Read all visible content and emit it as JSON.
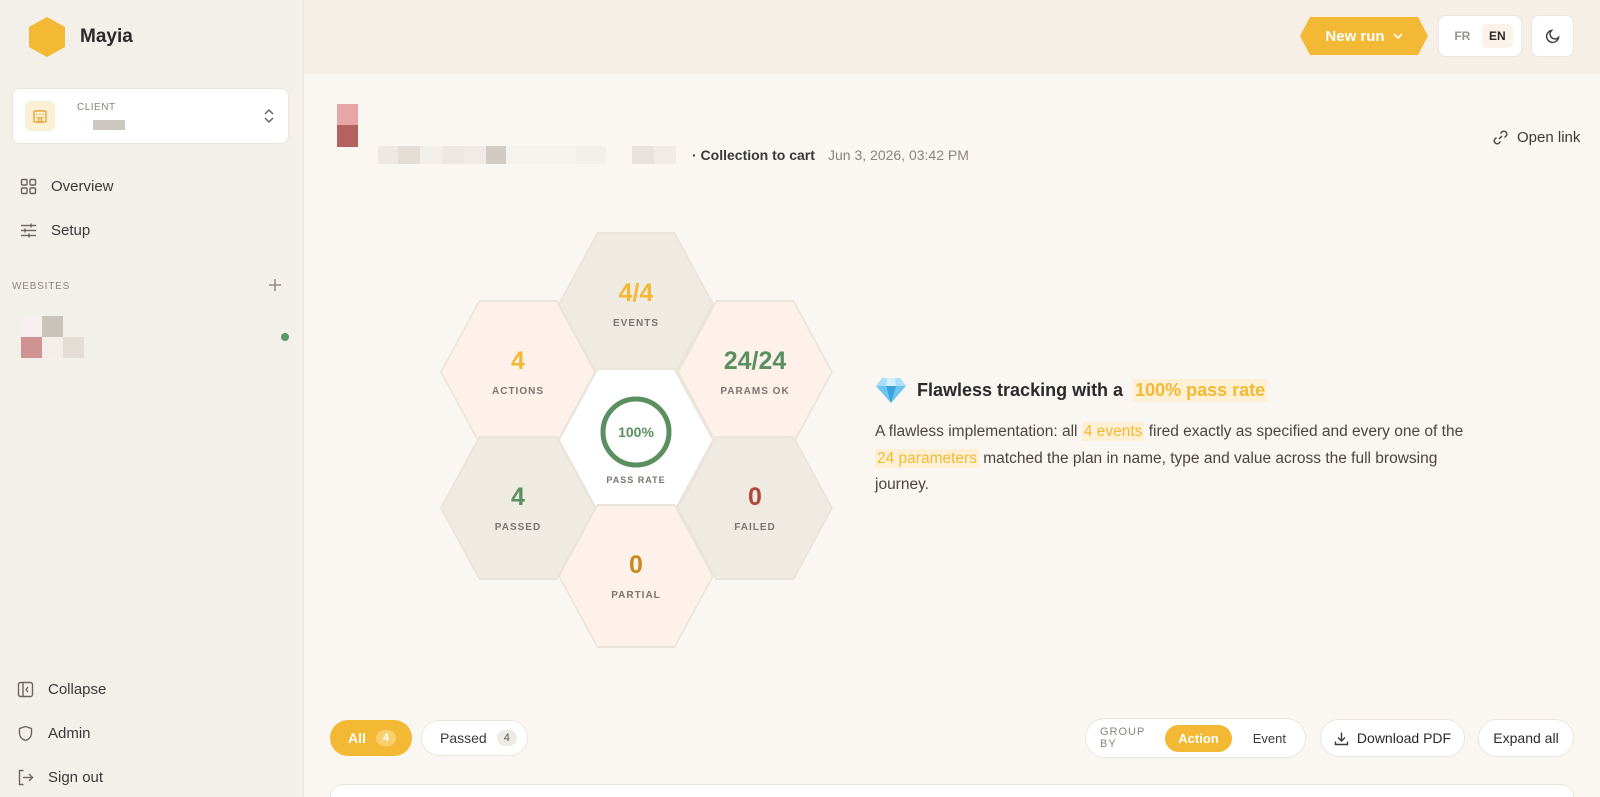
{
  "app": {
    "name": "Mayia"
  },
  "colors": {
    "accent": "#f3b934",
    "success": "#5a8f5f",
    "danger": "#b0473a",
    "warning": "#c8891e"
  },
  "sidebar": {
    "client_label": "CLIENT",
    "nav": [
      {
        "label": "Overview",
        "icon": "grid-icon"
      },
      {
        "label": "Setup",
        "icon": "sliders-icon"
      }
    ],
    "websites_label": "WEBSITES",
    "bottom": [
      {
        "label": "Collapse",
        "icon": "sidebar-collapse-icon"
      },
      {
        "label": "Admin",
        "icon": "shield-icon"
      },
      {
        "label": "Sign out",
        "icon": "sign-out-icon"
      }
    ]
  },
  "topbar": {
    "new_run_label": "New run",
    "lang_fr": "FR",
    "lang_en": "EN",
    "active_lang": "EN"
  },
  "run": {
    "name": "· Collection to cart",
    "date": "Jun 3, 2026, 03:42 PM",
    "open_link_label": "Open link"
  },
  "stats": {
    "events": {
      "value": "4/4",
      "label": "EVENTS"
    },
    "actions": {
      "value": "4",
      "label": "ACTIONS"
    },
    "params": {
      "value": "24/24",
      "label": "PARAMS OK"
    },
    "pass_rate": {
      "value": "100%",
      "label": "PASS RATE",
      "fraction": 1.0
    },
    "passed": {
      "value": "4",
      "label": "PASSED"
    },
    "failed": {
      "value": "0",
      "label": "FAILED"
    },
    "partial": {
      "value": "0",
      "label": "PARTIAL"
    }
  },
  "summary": {
    "title_prefix": "Flawless tracking with a",
    "title_highlight": "100% pass rate",
    "body_1": "A flawless implementation: all",
    "body_hl_1": "4 events",
    "body_2": "fired exactly as specified and every one of the",
    "body_hl_2": "24 parameters",
    "body_3": "matched the plan in name, type and value across the full browsing journey."
  },
  "filters": {
    "all_label": "All",
    "all_count": "4",
    "passed_label": "Passed",
    "passed_count": "4"
  },
  "group_by": {
    "label": "GROUP BY",
    "options": [
      "Action",
      "Event"
    ],
    "selected": "Action"
  },
  "actions": {
    "download_pdf": "Download PDF",
    "expand_all": "Expand all"
  }
}
